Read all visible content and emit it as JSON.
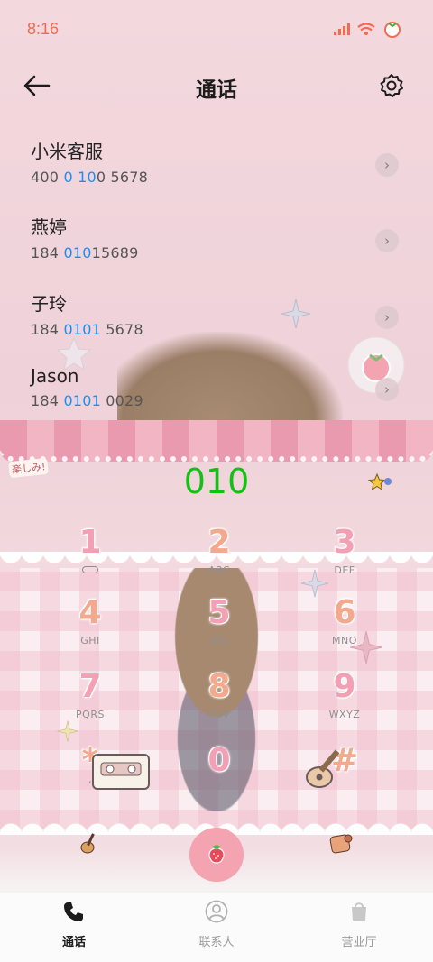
{
  "status": {
    "time": "8:16"
  },
  "header": {
    "title": "通话"
  },
  "contacts": [
    {
      "name": "小米客服",
      "num_pre": "400 ",
      "num_hl": "0 10",
      "num_post": "0 5678"
    },
    {
      "name": "燕婷",
      "num_pre": "184 ",
      "num_hl": "010",
      "num_post": "15689"
    },
    {
      "name": "子玲",
      "num_pre": "184 ",
      "num_hl": "0101",
      "num_post": " 5678"
    },
    {
      "name": "Jason",
      "num_pre": "184 ",
      "num_hl": "0101",
      "num_post": " 0029"
    }
  ],
  "dialer": {
    "input": "010",
    "sticker_text": "楽しみ!"
  },
  "keys": [
    {
      "digit": "1",
      "letters": ""
    },
    {
      "digit": "2",
      "letters": "ABC"
    },
    {
      "digit": "3",
      "letters": "DEF"
    },
    {
      "digit": "4",
      "letters": "GHI"
    },
    {
      "digit": "5",
      "letters": "JKL"
    },
    {
      "digit": "6",
      "letters": "MNO"
    },
    {
      "digit": "7",
      "letters": "PQRS"
    },
    {
      "digit": "8",
      "letters": "TUV"
    },
    {
      "digit": "9",
      "letters": "WXYZ"
    },
    {
      "digit": "*",
      "letters": ","
    },
    {
      "digit": "0",
      "letters": "+"
    },
    {
      "digit": "#",
      "letters": ""
    }
  ],
  "nav": [
    {
      "label": "通话",
      "icon": "phone-icon",
      "active": true
    },
    {
      "label": "联系人",
      "icon": "person-icon",
      "active": false
    },
    {
      "label": "营业厅",
      "icon": "shopping-bag-icon",
      "active": false
    }
  ],
  "colors": {
    "accent": "#13c113",
    "highlight": "#1a8ff0",
    "status": "#f26a4f",
    "key": "#f39fb4",
    "call_button": "#f4a3b0"
  }
}
